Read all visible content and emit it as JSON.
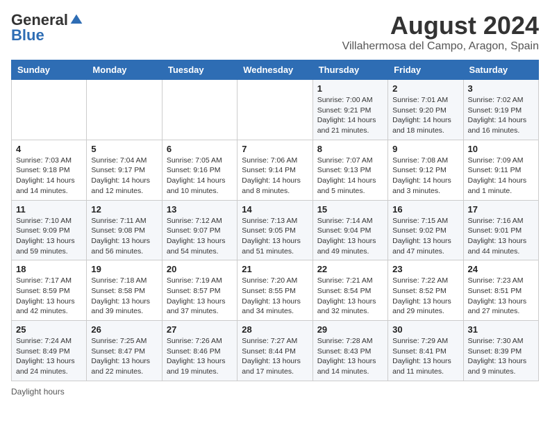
{
  "header": {
    "logo": {
      "general": "General",
      "blue": "Blue"
    },
    "month_year": "August 2024",
    "location": "Villahermosa del Campo, Aragon, Spain"
  },
  "weekdays": [
    "Sunday",
    "Monday",
    "Tuesday",
    "Wednesday",
    "Thursday",
    "Friday",
    "Saturday"
  ],
  "weeks": [
    [
      {
        "day": "",
        "info": ""
      },
      {
        "day": "",
        "info": ""
      },
      {
        "day": "",
        "info": ""
      },
      {
        "day": "",
        "info": ""
      },
      {
        "day": "1",
        "info": "Sunrise: 7:00 AM\nSunset: 9:21 PM\nDaylight: 14 hours and 21 minutes."
      },
      {
        "day": "2",
        "info": "Sunrise: 7:01 AM\nSunset: 9:20 PM\nDaylight: 14 hours and 18 minutes."
      },
      {
        "day": "3",
        "info": "Sunrise: 7:02 AM\nSunset: 9:19 PM\nDaylight: 14 hours and 16 minutes."
      }
    ],
    [
      {
        "day": "4",
        "info": "Sunrise: 7:03 AM\nSunset: 9:18 PM\nDaylight: 14 hours and 14 minutes."
      },
      {
        "day": "5",
        "info": "Sunrise: 7:04 AM\nSunset: 9:17 PM\nDaylight: 14 hours and 12 minutes."
      },
      {
        "day": "6",
        "info": "Sunrise: 7:05 AM\nSunset: 9:16 PM\nDaylight: 14 hours and 10 minutes."
      },
      {
        "day": "7",
        "info": "Sunrise: 7:06 AM\nSunset: 9:14 PM\nDaylight: 14 hours and 8 minutes."
      },
      {
        "day": "8",
        "info": "Sunrise: 7:07 AM\nSunset: 9:13 PM\nDaylight: 14 hours and 5 minutes."
      },
      {
        "day": "9",
        "info": "Sunrise: 7:08 AM\nSunset: 9:12 PM\nDaylight: 14 hours and 3 minutes."
      },
      {
        "day": "10",
        "info": "Sunrise: 7:09 AM\nSunset: 9:11 PM\nDaylight: 14 hours and 1 minute."
      }
    ],
    [
      {
        "day": "11",
        "info": "Sunrise: 7:10 AM\nSunset: 9:09 PM\nDaylight: 13 hours and 59 minutes."
      },
      {
        "day": "12",
        "info": "Sunrise: 7:11 AM\nSunset: 9:08 PM\nDaylight: 13 hours and 56 minutes."
      },
      {
        "day": "13",
        "info": "Sunrise: 7:12 AM\nSunset: 9:07 PM\nDaylight: 13 hours and 54 minutes."
      },
      {
        "day": "14",
        "info": "Sunrise: 7:13 AM\nSunset: 9:05 PM\nDaylight: 13 hours and 51 minutes."
      },
      {
        "day": "15",
        "info": "Sunrise: 7:14 AM\nSunset: 9:04 PM\nDaylight: 13 hours and 49 minutes."
      },
      {
        "day": "16",
        "info": "Sunrise: 7:15 AM\nSunset: 9:02 PM\nDaylight: 13 hours and 47 minutes."
      },
      {
        "day": "17",
        "info": "Sunrise: 7:16 AM\nSunset: 9:01 PM\nDaylight: 13 hours and 44 minutes."
      }
    ],
    [
      {
        "day": "18",
        "info": "Sunrise: 7:17 AM\nSunset: 8:59 PM\nDaylight: 13 hours and 42 minutes."
      },
      {
        "day": "19",
        "info": "Sunrise: 7:18 AM\nSunset: 8:58 PM\nDaylight: 13 hours and 39 minutes."
      },
      {
        "day": "20",
        "info": "Sunrise: 7:19 AM\nSunset: 8:57 PM\nDaylight: 13 hours and 37 minutes."
      },
      {
        "day": "21",
        "info": "Sunrise: 7:20 AM\nSunset: 8:55 PM\nDaylight: 13 hours and 34 minutes."
      },
      {
        "day": "22",
        "info": "Sunrise: 7:21 AM\nSunset: 8:54 PM\nDaylight: 13 hours and 32 minutes."
      },
      {
        "day": "23",
        "info": "Sunrise: 7:22 AM\nSunset: 8:52 PM\nDaylight: 13 hours and 29 minutes."
      },
      {
        "day": "24",
        "info": "Sunrise: 7:23 AM\nSunset: 8:51 PM\nDaylight: 13 hours and 27 minutes."
      }
    ],
    [
      {
        "day": "25",
        "info": "Sunrise: 7:24 AM\nSunset: 8:49 PM\nDaylight: 13 hours and 24 minutes."
      },
      {
        "day": "26",
        "info": "Sunrise: 7:25 AM\nSunset: 8:47 PM\nDaylight: 13 hours and 22 minutes."
      },
      {
        "day": "27",
        "info": "Sunrise: 7:26 AM\nSunset: 8:46 PM\nDaylight: 13 hours and 19 minutes."
      },
      {
        "day": "28",
        "info": "Sunrise: 7:27 AM\nSunset: 8:44 PM\nDaylight: 13 hours and 17 minutes."
      },
      {
        "day": "29",
        "info": "Sunrise: 7:28 AM\nSunset: 8:43 PM\nDaylight: 13 hours and 14 minutes."
      },
      {
        "day": "30",
        "info": "Sunrise: 7:29 AM\nSunset: 8:41 PM\nDaylight: 13 hours and 11 minutes."
      },
      {
        "day": "31",
        "info": "Sunrise: 7:30 AM\nSunset: 8:39 PM\nDaylight: 13 hours and 9 minutes."
      }
    ]
  ],
  "footer": {
    "daylight_label": "Daylight hours"
  }
}
